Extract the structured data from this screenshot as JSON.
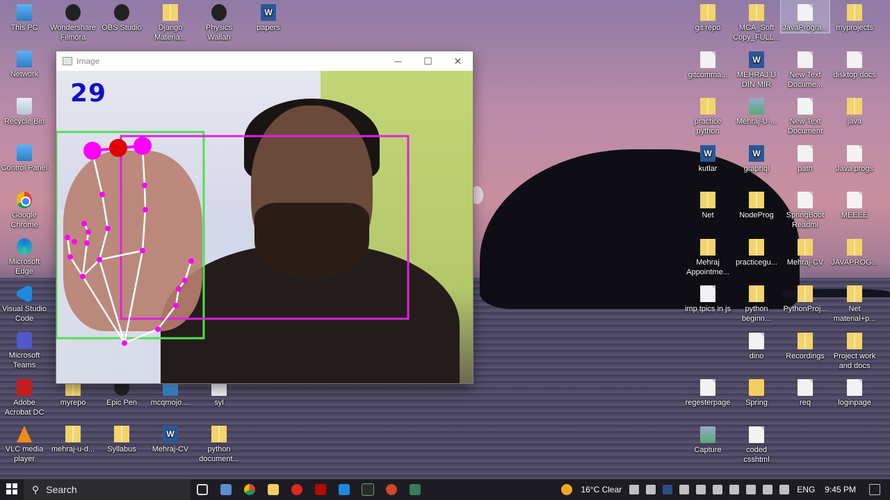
{
  "desktop": {
    "icons_left": [
      {
        "label": "This PC",
        "type": "pc"
      },
      {
        "label": "Wondershare Filmora",
        "type": "blk"
      },
      {
        "label": "OBS Studio",
        "type": "blk"
      },
      {
        "label": "Django Materia...",
        "type": "zip"
      },
      {
        "label": "Physics Wallah",
        "type": "blk"
      },
      {
        "label": "papers",
        "type": "word"
      },
      {
        "label": "Network",
        "type": "pc"
      },
      {
        "label": "Recycle Bin",
        "type": "bin"
      },
      {
        "label": "Control Panel",
        "type": "pc"
      },
      {
        "label": "Google Chrome",
        "type": "chrome"
      },
      {
        "label": "Microsoft Edge",
        "type": "edge"
      },
      {
        "label": "Visual Studio Code",
        "type": "vsc"
      },
      {
        "label": "Microsoft Teams",
        "type": "teams"
      },
      {
        "label": "Adobe Acrobat DC",
        "type": "red"
      },
      {
        "label": "VLC media player",
        "type": "cone"
      },
      {
        "label": "myrepo",
        "type": "zip"
      },
      {
        "label": "Epic Pen",
        "type": "blk"
      },
      {
        "label": "mcqmojo....",
        "type": "pc"
      },
      {
        "label": "syl",
        "type": "doc"
      },
      {
        "label": "mehraj-u-d...",
        "type": "zip"
      },
      {
        "label": "Syllabus",
        "type": "zip"
      },
      {
        "label": "Mehraj-CV",
        "type": "word"
      },
      {
        "label": "python document...",
        "type": "zip"
      }
    ],
    "icons_right": [
      {
        "label": "git repo",
        "type": "zip"
      },
      {
        "label": "MCA_Soft Copy_FULL...",
        "type": "zip"
      },
      {
        "label": "JavaProgra...",
        "type": "doc"
      },
      {
        "label": "myprojects",
        "type": "zip"
      },
      {
        "label": "gitcomma...",
        "type": "doc"
      },
      {
        "label": "MEHRAJ U DIN MIR",
        "type": "word"
      },
      {
        "label": "New Text Docume...",
        "type": "doc"
      },
      {
        "label": "disktop docs",
        "type": "doc"
      },
      {
        "label": "practice python",
        "type": "zip"
      },
      {
        "label": "Mehraj-U-...",
        "type": "img"
      },
      {
        "label": "New Text Document",
        "type": "doc"
      },
      {
        "label": "java",
        "type": "zip"
      },
      {
        "label": "kutlar",
        "type": "word"
      },
      {
        "label": "graphql",
        "type": "word"
      },
      {
        "label": "path",
        "type": "doc"
      },
      {
        "label": "Java progs",
        "type": "doc"
      },
      {
        "label": "Net",
        "type": "zip"
      },
      {
        "label": "NodeProg",
        "type": "zip"
      },
      {
        "label": "SpringBoot Readmi",
        "type": "doc"
      },
      {
        "label": "MEEEE",
        "type": "doc"
      },
      {
        "label": "Mehraj Appointme...",
        "type": "zip"
      },
      {
        "label": "practicegu...",
        "type": "zip"
      },
      {
        "label": "Mehraj-CV",
        "type": "zip"
      },
      {
        "label": "JAVAPROG...",
        "type": "zip"
      },
      {
        "label": "imp tpics in js",
        "type": "doc"
      },
      {
        "label": "python beginn...",
        "type": "zip"
      },
      {
        "label": "PythonProj...",
        "type": "zip"
      },
      {
        "label": "Net material+p...",
        "type": "zip"
      },
      {
        "label": "dino",
        "type": "doc"
      },
      {
        "label": "Recordings",
        "type": "zip"
      },
      {
        "label": "Project work and docs",
        "type": "zip"
      },
      {
        "label": "regesterpage",
        "type": "doc"
      },
      {
        "label": "Spring",
        "type": "folder"
      },
      {
        "label": "req",
        "type": "doc"
      },
      {
        "label": "loginpage",
        "type": "doc"
      },
      {
        "label": "Capture",
        "type": "img"
      },
      {
        "label": "coded csshtml",
        "type": "doc"
      }
    ]
  },
  "window": {
    "title": "Image",
    "minimize": "─",
    "maximize": "☐",
    "close": "✕",
    "finger_count": "29"
  },
  "taskbar": {
    "search_placeholder": "Search",
    "weather": "16°C  Clear",
    "language": "ENG",
    "time": "9:45 PM"
  },
  "colors": {
    "landmark": "#ff00ff",
    "skeleton": "#ffffff",
    "active_tip": "#e00000",
    "hand_box": "#50e050",
    "face_box": "#e020e0",
    "counter_text": "#1010c8"
  }
}
